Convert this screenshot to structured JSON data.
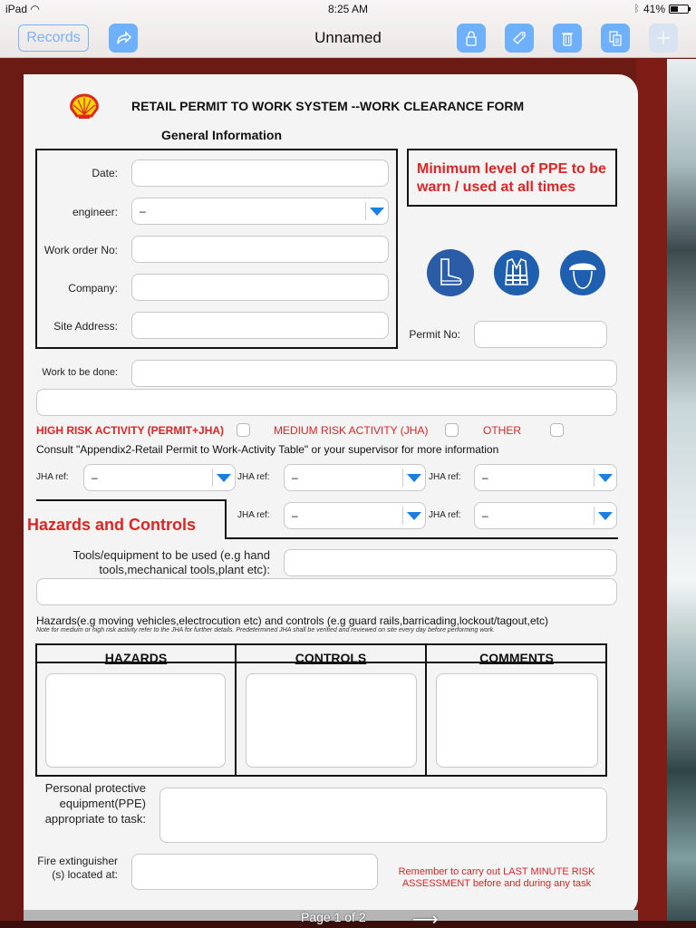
{
  "status_bar": {
    "device": "iPad",
    "time": "8:25 AM",
    "battery": "41%"
  },
  "nav": {
    "records_label": "Records",
    "title": "Unnamed",
    "icons": [
      "share-icon",
      "lock-icon",
      "tag-icon",
      "trash-icon",
      "copy-icon",
      "add-icon"
    ]
  },
  "form": {
    "title": "RETAIL PERMIT TO WORK SYSTEM --WORK CLEARANCE FORM",
    "general_info_heading": "General Information",
    "fields": {
      "date": {
        "label": "Date:",
        "value": ""
      },
      "engineer": {
        "label": "engineer:",
        "value": "–"
      },
      "work_order": {
        "label": "Work order No:",
        "value": ""
      },
      "company": {
        "label": "Company:",
        "value": ""
      },
      "site_address": {
        "label": "Site Address:",
        "value": ""
      },
      "permit_no": {
        "label": "Permit No:",
        "value": ""
      },
      "work_to_be_done": {
        "label": "Work to be done:",
        "value": ""
      }
    },
    "ppe_note": "Minimum level of PPE to be warn / used at all times",
    "ppe_icons": [
      "safety-boots-icon",
      "hi-vis-vest-icon",
      "hard-hat-icon"
    ],
    "risk": {
      "high": {
        "label": "HIGH RISK ACTIVITY (PERMIT+JHA)",
        "checked": false
      },
      "medium": {
        "label": "MEDIUM RISK ACTIVITY (JHA)",
        "checked": false
      },
      "other": {
        "label": "OTHER",
        "checked": false
      }
    },
    "consult_note": "Consult \"Appendix2-Retail Permit to Work-Activity Table\" or your supervisor for more information",
    "jha_refs": [
      {
        "label": "JHA ref:",
        "value": "–"
      },
      {
        "label": "JHA ref:",
        "value": "–"
      },
      {
        "label": "JHA ref:",
        "value": "–"
      },
      {
        "label": "JHA ref:",
        "value": "–"
      },
      {
        "label": "JHA ref:",
        "value": "–"
      }
    ],
    "hazards_heading": "Hazards and Controls",
    "tools_label": "Tools/equipment to be used (e.g hand tools,mechanical tools,plant etc):",
    "hazards_desc": "Hazards(e.g moving vehicles,electrocution etc) and controls (e.g guard rails,barricading,lockout/tagout,etc)",
    "hazards_note": "Note for medium or high risk activity refer to the JHA for further details. Predetermined JHA shall be verified and reviewed on site every day before performing work.",
    "table_headers": [
      "HAZARDS",
      "CONTROLS",
      "COMMENTS"
    ],
    "ppe_label": "Personal protective equipment(PPE) appropriate to task:",
    "fire_label": "Fire extinguisher (s) located at:",
    "remember_note": "Remember to carry out LAST MINUTE RISK ASSESSMENT before and during any task"
  },
  "footer": {
    "page_label": "Page 1 of 2"
  },
  "colors": {
    "accent": "#6fb0fb",
    "warning_red": "#e02424",
    "dropdown_blue": "#1a7fe0",
    "ppe_blue": "#2a5ca8",
    "background_red": "#7e1c16"
  }
}
